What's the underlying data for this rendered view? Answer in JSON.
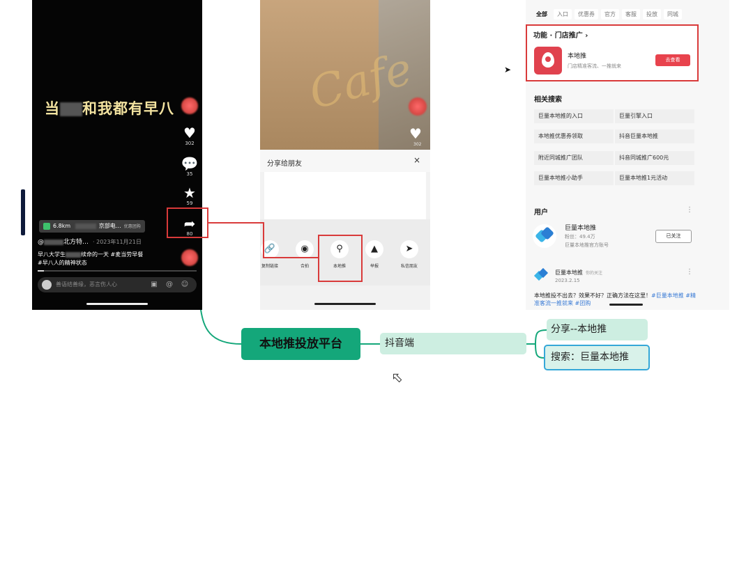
{
  "phone1": {
    "caption_pre": "当",
    "caption_post": "和我都有早八",
    "counts": {
      "like": "302",
      "comment": "35",
      "star": "59",
      "share": "80"
    },
    "icons": {
      "like": "heart-icon",
      "comment": "comment-icon",
      "star": "star-icon",
      "share": "share-arrow-icon"
    },
    "location": {
      "distance": "6.8km",
      "shop": "京部电…",
      "tag": "优惠团购"
    },
    "author": "@",
    "author_name": "北方特…",
    "date": "· 2023年11月21日",
    "desc_line1": "早八大学生",
    "desc_line1b": "续命的一天 #麦当劳早餐",
    "desc_line2": "#早八人的精神状态",
    "progress": 0.04,
    "comment_placeholder": "善语结善缘，恶言伤人心"
  },
  "phone2": {
    "watermark": "Cafe",
    "like_count": "302",
    "sheet_title": "分享给朋友",
    "close": "×",
    "share_items": [
      {
        "label": "复制链接",
        "icon": "🔗"
      },
      {
        "label": "合拍",
        "icon": "◉"
      },
      {
        "label": "本地推",
        "icon": "⚲"
      },
      {
        "label": "举报",
        "icon": "▲"
      },
      {
        "label": "私信朋友",
        "icon": "➤"
      }
    ]
  },
  "panel": {
    "tabs": [
      "全部",
      "入口",
      "优惠券",
      "官方",
      "客服",
      "投放",
      "同城"
    ],
    "func_title": "功能 · 门店推广",
    "func_chevron": "›",
    "func_name": "本地推",
    "func_desc": "门店精准客流、一推就来",
    "func_button": "去查看",
    "related_title": "相关搜索",
    "related": [
      "巨量本地推的入口",
      "巨量引擎入口",
      "本地推优惠券领取",
      "抖音巨量本地推",
      "附近同城推广团队",
      "抖音同城推广600元",
      "巨量本地推小助手",
      "巨量本地推1元活动"
    ],
    "user_title": "用户",
    "more": "⋮",
    "user_name": "巨量本地推",
    "user_fans": "粉丝：49.4万",
    "user_verify": "巨量本地推官方账号",
    "follow_button": "已关注",
    "post_name": "巨量本地推",
    "post_tag": "你的关注",
    "post_date": "2023.2.15",
    "post_text": "本地推投不出去？效果不好？正确方法在这里！",
    "post_links": "#巨量本地推 #精准客流一推就来 #团购"
  },
  "mindmap": {
    "root": "本地推投放平台",
    "level1": "抖音端",
    "level2": [
      "分享--本地推",
      "搜索：巨量本地推"
    ]
  },
  "colors": {
    "highlight_red": "#d93a3a",
    "root_green": "#14a77a",
    "node_mint": "#cdeee1",
    "selected_blue": "#34a7d8",
    "button_red": "#e8434d"
  }
}
